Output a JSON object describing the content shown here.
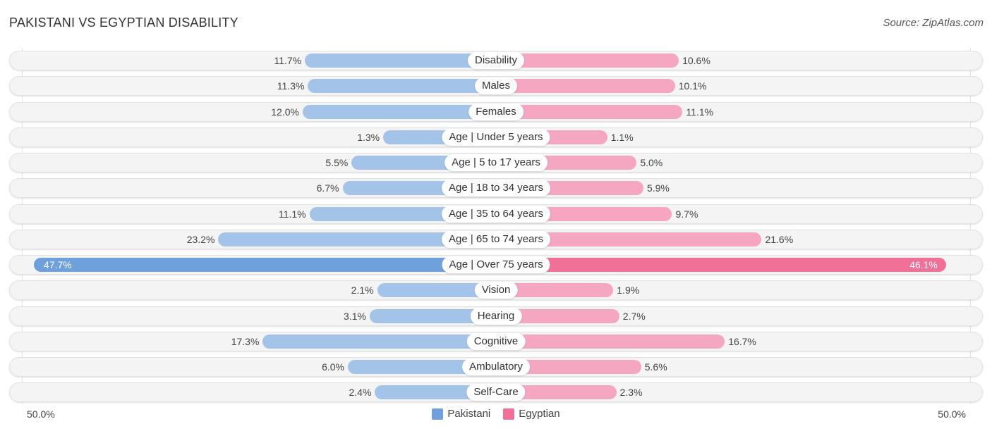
{
  "header": {
    "title": "PAKISTANI VS EGYPTIAN DISABILITY",
    "source": "Source: ZipAtlas.com"
  },
  "colors": {
    "pakistani": "#a3c4e8",
    "pakistani_highlight": "#6ea0dc",
    "egyptian": "#f5a6c0",
    "egyptian_highlight": "#f07098",
    "legend_pakistani": "#6ea0dc",
    "legend_egyptian": "#f07098"
  },
  "chart_data": {
    "type": "bar",
    "orientation": "horizontal-diverging",
    "title": "PAKISTANI VS EGYPTIAN DISABILITY",
    "categories": [
      "Disability",
      "Males",
      "Females",
      "Age | Under 5 years",
      "Age | 5 to 17 years",
      "Age | 18 to 34 years",
      "Age | 35 to 64 years",
      "Age | 65 to 74 years",
      "Age | Over 75 years",
      "Vision",
      "Hearing",
      "Cognitive",
      "Ambulatory",
      "Self-Care"
    ],
    "series": [
      {
        "name": "Pakistani",
        "side": "left",
        "values": [
          11.7,
          11.3,
          12.0,
          1.3,
          5.5,
          6.7,
          11.1,
          23.2,
          47.7,
          2.1,
          3.1,
          17.3,
          6.0,
          2.4
        ]
      },
      {
        "name": "Egyptian",
        "side": "right",
        "values": [
          10.6,
          10.1,
          11.1,
          1.1,
          5.0,
          5.9,
          9.7,
          21.6,
          46.1,
          1.9,
          2.7,
          16.7,
          5.6,
          2.3
        ]
      }
    ],
    "value_labels_pakistani": [
      "11.7%",
      "11.3%",
      "12.0%",
      "1.3%",
      "5.5%",
      "6.7%",
      "11.1%",
      "23.2%",
      "47.7%",
      "2.1%",
      "3.1%",
      "17.3%",
      "6.0%",
      "2.4%"
    ],
    "value_labels_egyptian": [
      "10.6%",
      "10.1%",
      "11.1%",
      "1.1%",
      "5.0%",
      "5.9%",
      "9.7%",
      "21.6%",
      "46.1%",
      "1.9%",
      "2.7%",
      "16.7%",
      "5.6%",
      "2.3%"
    ],
    "highlight_index": 8,
    "axis": {
      "left_label": "50.0%",
      "right_label": "50.0%",
      "range": [
        0,
        50
      ]
    },
    "legend": [
      {
        "name": "Pakistani"
      },
      {
        "name": "Egyptian"
      }
    ],
    "legend_position": "bottom-center",
    "grid": false
  }
}
